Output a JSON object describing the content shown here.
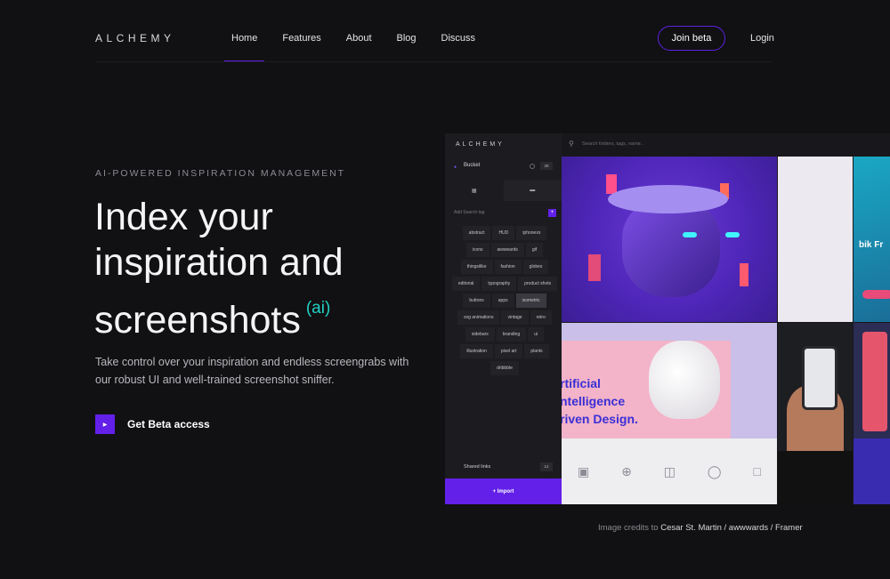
{
  "nav": {
    "logo": "ALCHEMY",
    "links": [
      "Home",
      "Features",
      "About",
      "Blog",
      "Discuss"
    ],
    "join_label": "Join beta",
    "login_label": "Login"
  },
  "hero": {
    "eyebrow": "AI-POWERED INSPIRATION MANAGEMENT",
    "headline_1": "Index your",
    "headline_2": "inspiration and",
    "headline_3": "screenshots",
    "headline_ai": "(ai)",
    "sub": "Take control over your inspiration and endless screengrabs with our robust UI and well-trained screenshot sniffer.",
    "cta_label": "Get Beta access"
  },
  "app": {
    "logo": "ALCHEMY",
    "bucket_label": "Bucket",
    "bucket_count": "30",
    "tag_placeholder": "Add Search tag",
    "tags": [
      "abstract",
      "HUD",
      "iphonexs",
      "icons",
      "awwwards",
      "gif",
      "thingsilike",
      "fashion",
      "globes",
      "editorial",
      "typography",
      "product shots",
      "buttons",
      "apps",
      "isometric",
      "svg animations",
      "vintage",
      "retro",
      "sidebars",
      "branding",
      "ui",
      "illustration",
      "pixel art",
      "plants",
      "dribbble"
    ],
    "highlighted_tag": "isometric",
    "shared_label": "Shared links",
    "shared_count": "12",
    "import_label": "+ Import",
    "search_placeholder": "Search folders, tags, name..",
    "tile_text": {
      "card_line_1": "rtificial",
      "card_line_2": "ntelligence",
      "card_line_3": "riven Design.",
      "side_word": "bik Fr"
    }
  },
  "credits": {
    "prefix": "Image credits to",
    "names": "Cesar St. Martin / awwwards / Framer"
  },
  "colors": {
    "accent": "#6220e8",
    "ai_teal": "#23d0c4",
    "background": "#111012"
  }
}
